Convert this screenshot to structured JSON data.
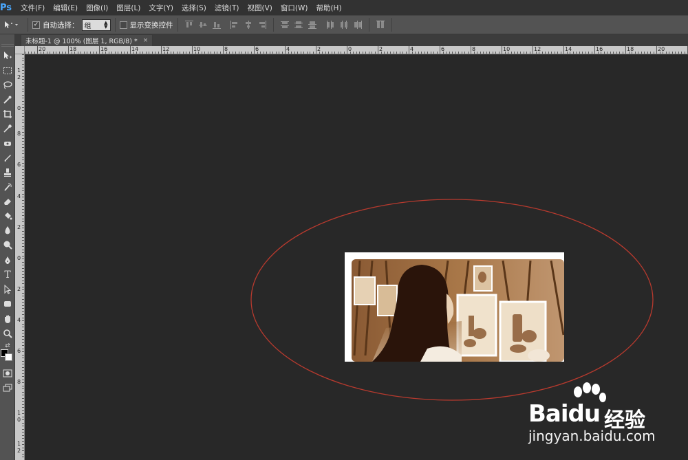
{
  "app": {
    "logo": "Ps"
  },
  "menu": [
    "文件(F)",
    "编辑(E)",
    "图像(I)",
    "图层(L)",
    "文字(Y)",
    "选择(S)",
    "滤镜(T)",
    "视图(V)",
    "窗口(W)",
    "帮助(H)"
  ],
  "options": {
    "auto_select_label": "自动选择：",
    "auto_select_checked": true,
    "auto_select_value": "组",
    "show_transform_label": "显示变换控件",
    "show_transform_checked": false
  },
  "document": {
    "tab_title": "未标题-1 @ 100% (图层 1, RGB/8) *",
    "close": "×"
  },
  "rulers": {
    "horizontal": [
      "20",
      "18",
      "16",
      "14",
      "12",
      "10",
      "8",
      "6",
      "4",
      "2",
      "0",
      "2",
      "4",
      "6",
      "8",
      "10",
      "12",
      "14",
      "16",
      "18",
      "20"
    ],
    "vertical": [
      "1",
      "2",
      "0",
      "8",
      "6",
      "4",
      "2",
      "0",
      "2",
      "4",
      "6",
      "8",
      "1",
      "0",
      "1",
      "2"
    ]
  },
  "annotation": {
    "shape": "ellipse",
    "color": "#b83a2e"
  },
  "watermark": {
    "brand": "Baidu",
    "cn": "经验",
    "url": "jingyan.baidu.com"
  },
  "colors": {
    "accent": "#4aa8ff",
    "canvas_bg": "#282828",
    "panel_bg": "#535353"
  }
}
